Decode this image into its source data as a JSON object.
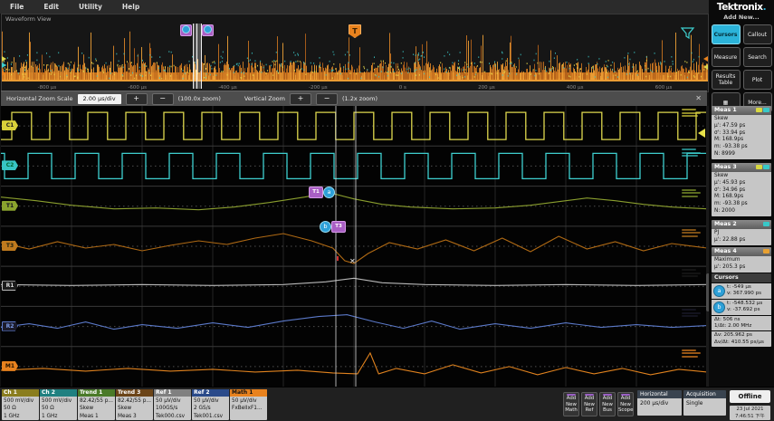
{
  "menu": {
    "items": [
      "File",
      "Edit",
      "Utility",
      "Help"
    ]
  },
  "overview": {
    "title": "Waveform View",
    "axis_labels": [
      "-800 µs",
      "-600 µs",
      "-400 µs",
      "-200 µs",
      "0 s",
      "200 µs",
      "400 µs",
      "600 µs"
    ],
    "trigger_label": "T",
    "handle_a": "a",
    "handle_b": "b"
  },
  "zoom_toolbar": {
    "h_label": "Horizontal Zoom Scale",
    "scale_value": "2.00 µs/div",
    "zoom_in": "+",
    "zoom_out": "−",
    "h_zoom_readout": "(100.0x zoom)",
    "v_label": "Vertical Zoom",
    "v_zoom_readout": "(1.2x zoom)",
    "close": "✕"
  },
  "cursor_bubbles": {
    "a": "a",
    "b": "b",
    "t1": "T1",
    "t3": "T3"
  },
  "badges": [
    "C1",
    "C2",
    "T1",
    "T3",
    "R1",
    "R2",
    "M1"
  ],
  "sidebar": {
    "logo": "Tektronix",
    "add_new_label": "Add New...",
    "buttons": [
      {
        "label": "Cursors"
      },
      {
        "label": "Callout"
      },
      {
        "label": "Measure"
      },
      {
        "label": "Search"
      },
      {
        "label": "Results Table"
      },
      {
        "label": "Plot"
      },
      {
        "label": "▦"
      },
      {
        "label": "More..."
      }
    ],
    "measurements": [
      {
        "title": "Meas 1",
        "chips": [
          "#d8d840",
          "#38c8c8"
        ],
        "lines": [
          "Skew",
          "µ': 47.59 ps",
          "σ': 33.94 ps",
          "M: 168.9ps",
          "m: -93.38 ps",
          "N: 8999"
        ]
      },
      {
        "title": "Meas 3",
        "chips": [
          "#d8d840",
          "#38c8c8"
        ],
        "lines": [
          "Skew",
          "µ': 45.93 ps",
          "σ': 34.96 ps",
          "M: 168.9ps",
          "m: -93.38 ps",
          "N: 2000"
        ]
      },
      {
        "title": "Meas 2",
        "chips": [
          "#38c8c8"
        ],
        "lines": [
          "PJ",
          "µ': 22.88 ps"
        ]
      },
      {
        "title": "Meas 4",
        "chips": [
          "#e8a030"
        ],
        "lines": [
          "Maximum",
          "µ': 205.3 ps"
        ]
      }
    ],
    "cursors_panel": {
      "title": "Cursors",
      "a_label": "a",
      "b_label": "b",
      "a_lines": [
        "t: -549 µs",
        "v: 367.990 ps"
      ],
      "b_lines": [
        "t: -548.532 µs",
        "v: -37.692 ps"
      ],
      "delta_lines_1": [
        "Δt: 506 ns",
        "1/Δt: 2.00 MHz"
      ],
      "delta_lines_2": [
        "Δv: 205.962 ps",
        "Δv/Δt: 410.55 ps/µs"
      ]
    }
  },
  "channels": [
    {
      "name": "Ch 1",
      "color": "#8a7d1e",
      "text": "#fff",
      "badge_bg": "#d8cf3a",
      "badge_fg": "#222",
      "lines": [
        "500 mV/div",
        "50 Ω",
        "1 GHz"
      ]
    },
    {
      "name": "Ch 2",
      "color": "#1f8080",
      "text": "#fff",
      "badge_bg": "#38c4c4",
      "badge_fg": "#063",
      "lines": [
        "500 mV/div",
        "50 Ω",
        "1 GHz"
      ]
    },
    {
      "name": "Trend 1",
      "color": "#4a7a28",
      "text": "#fff",
      "badge_bg": "#8aa32e",
      "badge_fg": "#112",
      "lines": [
        "82.42/55 p...",
        "Skew",
        "Meas 1"
      ]
    },
    {
      "name": "Trend 3",
      "color": "#6b4418",
      "text": "#fff",
      "badge_bg": "#bf7a1e",
      "badge_fg": "#221",
      "lines": [
        "82.42/55 p...",
        "Skew",
        "Meas 3"
      ]
    },
    {
      "name": "Ref 1",
      "color": "#808080",
      "text": "#fff",
      "badge_bg": "#1c1c1c",
      "badge_fg": "#d8d8d8",
      "badge_border": "#bbb",
      "lines": [
        "50 µV/div",
        "100GS/s",
        "Tek000.csv"
      ]
    },
    {
      "name": "Ref 2",
      "color": "#2a4a8a",
      "text": "#fff",
      "badge_bg": "#1c1c2c",
      "badge_fg": "#7b9ae6",
      "badge_border": "#5b79c9",
      "lines": [
        "50 µV/div",
        "2 GS/s",
        "Tek001.csv"
      ]
    },
    {
      "name": "Math 1",
      "color": "#e8821e",
      "text": "#111",
      "badge_bg": "#e8821e",
      "badge_fg": "#221100",
      "lines": [
        "50 µV/div",
        "FxBellxF1..."
      ]
    }
  ],
  "add_new_buttons": [
    "Add\nNew\nMath",
    "Add\nNew\nRef",
    "Add\nNew\nBus",
    "Add\nNew\nScope"
  ],
  "horizontal_panel": {
    "title": "Horizontal",
    "value": "200 µs/div"
  },
  "acquisition_panel": {
    "title": "Acquisition",
    "value": "Single"
  },
  "offline_label": "Offline",
  "datetime": [
    "23 Jul 2021",
    "7:46:51 下午"
  ],
  "colors": {
    "accent_cyan": "#2bb3d9",
    "cursor_purple": "#a95fc4",
    "trigger_orange": "#e8821e"
  },
  "waveforms": {
    "traces": [
      {
        "name": "ch1",
        "type": "square",
        "color": "#ded84e",
        "row": 0,
        "period": 42,
        "duty": 0.52,
        "phase": 12,
        "amp": 15
      },
      {
        "name": "ch2",
        "type": "square",
        "color": "#3ecfcf",
        "row": 1,
        "period": 52,
        "duty": 0.5,
        "phase": 30,
        "amp": 14
      },
      {
        "name": "trend1",
        "type": "line",
        "color": "#8a9e2e",
        "row": 2,
        "points": [
          [
            0,
            -10
          ],
          [
            0.05,
            -6
          ],
          [
            0.1,
            -1
          ],
          [
            0.16,
            3
          ],
          [
            0.22,
            2
          ],
          [
            0.28,
            4
          ],
          [
            0.33,
            1
          ],
          [
            0.38,
            -4
          ],
          [
            0.43,
            -10
          ],
          [
            0.465,
            -15
          ],
          [
            0.5,
            -8
          ],
          [
            0.54,
            -2
          ],
          [
            0.58,
            1
          ],
          [
            0.64,
            3
          ],
          [
            0.7,
            2
          ],
          [
            0.75,
            -1
          ],
          [
            0.79,
            -5
          ],
          [
            0.83,
            -9
          ],
          [
            0.87,
            -6
          ],
          [
            0.91,
            -2
          ],
          [
            0.95,
            1
          ],
          [
            1,
            3
          ]
        ]
      },
      {
        "name": "trend3",
        "type": "line",
        "color": "#b06a14",
        "row": 3,
        "points": [
          [
            0,
            -4
          ],
          [
            0.04,
            3
          ],
          [
            0.08,
            -5
          ],
          [
            0.12,
            2
          ],
          [
            0.16,
            -2
          ],
          [
            0.2,
            5
          ],
          [
            0.24,
            -1
          ],
          [
            0.28,
            -6
          ],
          [
            0.32,
            -2
          ],
          [
            0.36,
            -9
          ],
          [
            0.4,
            -14
          ],
          [
            0.44,
            -6
          ],
          [
            0.47,
            2
          ],
          [
            0.487,
            16
          ],
          [
            0.5,
            19
          ],
          [
            0.52,
            8
          ],
          [
            0.55,
            -4
          ],
          [
            0.59,
            3
          ],
          [
            0.63,
            -7
          ],
          [
            0.67,
            5
          ],
          [
            0.71,
            -9
          ],
          [
            0.75,
            6
          ],
          [
            0.79,
            -11
          ],
          [
            0.83,
            3
          ],
          [
            0.87,
            -5
          ],
          [
            0.91,
            5
          ],
          [
            0.95,
            -3
          ],
          [
            1,
            2
          ]
        ]
      },
      {
        "name": "ref1",
        "type": "line",
        "color": "#b8b8b8",
        "row": 4,
        "points": [
          [
            0,
            -2
          ],
          [
            0.1,
            -1
          ],
          [
            0.2,
            -2
          ],
          [
            0.3,
            -1
          ],
          [
            0.4,
            -2
          ],
          [
            0.46,
            -5
          ],
          [
            0.5,
            -9
          ],
          [
            0.54,
            -4
          ],
          [
            0.6,
            -2
          ],
          [
            0.7,
            -1
          ],
          [
            0.8,
            -2
          ],
          [
            0.9,
            -1
          ],
          [
            1,
            -2
          ]
        ]
      },
      {
        "name": "ref2",
        "type": "line",
        "color": "#5b79c9",
        "row": 5,
        "points": [
          [
            0,
            1
          ],
          [
            0.04,
            -3
          ],
          [
            0.08,
            2
          ],
          [
            0.12,
            -5
          ],
          [
            0.16,
            3
          ],
          [
            0.2,
            -2
          ],
          [
            0.25,
            2
          ],
          [
            0.3,
            -4
          ],
          [
            0.35,
            1
          ],
          [
            0.4,
            -6
          ],
          [
            0.45,
            -11
          ],
          [
            0.49,
            -13
          ],
          [
            0.53,
            -5
          ],
          [
            0.57,
            2
          ],
          [
            0.61,
            -6
          ],
          [
            0.65,
            3
          ],
          [
            0.7,
            -3
          ],
          [
            0.75,
            2
          ],
          [
            0.8,
            -4
          ],
          [
            0.85,
            1
          ],
          [
            0.9,
            -2
          ],
          [
            0.95,
            1
          ],
          [
            1,
            -1
          ]
        ]
      },
      {
        "name": "math1",
        "type": "line",
        "color": "#e0821e",
        "row": 6,
        "points": [
          [
            0,
            4
          ],
          [
            0.06,
            2
          ],
          [
            0.12,
            5
          ],
          [
            0.18,
            2
          ],
          [
            0.24,
            5
          ],
          [
            0.3,
            3
          ],
          [
            0.36,
            6
          ],
          [
            0.42,
            4
          ],
          [
            0.47,
            7
          ],
          [
            0.505,
            8
          ],
          [
            0.523,
            -15
          ],
          [
            0.535,
            8
          ],
          [
            0.56,
            2
          ],
          [
            0.6,
            8
          ],
          [
            0.64,
            -2
          ],
          [
            0.68,
            7
          ],
          [
            0.72,
            0
          ],
          [
            0.76,
            9
          ],
          [
            0.8,
            1
          ],
          [
            0.84,
            8
          ],
          [
            0.88,
            2
          ],
          [
            0.92,
            9
          ],
          [
            0.96,
            3
          ],
          [
            1,
            6
          ]
        ]
      }
    ]
  }
}
